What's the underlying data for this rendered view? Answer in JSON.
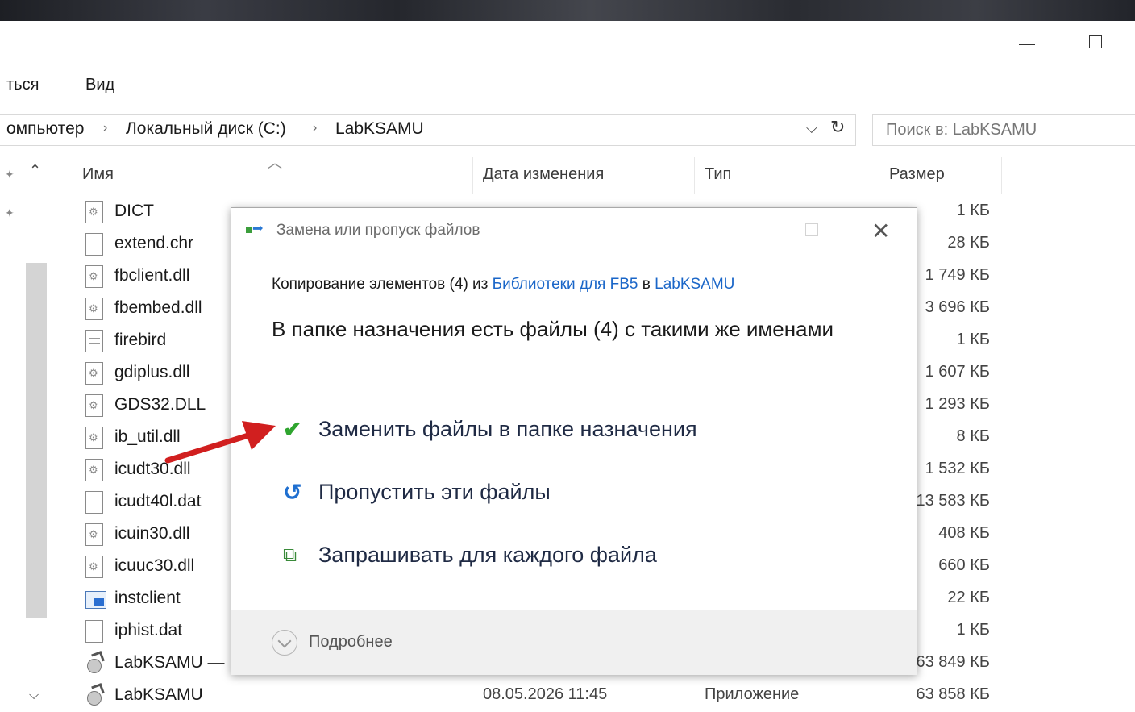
{
  "window": {
    "minimize": "minimize",
    "maximize": "maximize"
  },
  "ribbon": {
    "tab_partial": "ться",
    "tab_view": "Вид"
  },
  "address": {
    "crumb_computer": "омпьютер",
    "crumb_disk": "Локальный диск (C:)",
    "crumb_folder": "LabKSAMU",
    "separator": "›"
  },
  "search": {
    "placeholder": "Поиск в: LabKSAMU"
  },
  "columns": {
    "name": "Имя",
    "date": "Дата изменения",
    "type": "Тип",
    "size": "Размер"
  },
  "files": [
    {
      "name": "DICT",
      "size": "1 КБ",
      "icon": "settings-file-icon"
    },
    {
      "name": "extend.chr",
      "size": "28 КБ",
      "icon": "blank-file-icon"
    },
    {
      "name": "fbclient.dll",
      "size": "1 749 КБ",
      "icon": "dll-file-icon"
    },
    {
      "name": "fbembed.dll",
      "size": "3 696 КБ",
      "icon": "dll-file-icon"
    },
    {
      "name": "firebird",
      "size": "1 КБ",
      "icon": "text-file-icon"
    },
    {
      "name": "gdiplus.dll",
      "size": "1 607 КБ",
      "icon": "dll-file-icon"
    },
    {
      "name": "GDS32.DLL",
      "size": "1 293 КБ",
      "icon": "dll-file-icon"
    },
    {
      "name": "ib_util.dll",
      "size": "8 КБ",
      "icon": "dll-file-icon"
    },
    {
      "name": "icudt30.dll",
      "size": "1 532 КБ",
      "icon": "dll-file-icon"
    },
    {
      "name": "icudt40l.dat",
      "size": "13 583 КБ",
      "icon": "blank-file-icon"
    },
    {
      "name": "icuin30.dll",
      "size": "408 КБ",
      "icon": "dll-file-icon"
    },
    {
      "name": "icuuc30.dll",
      "size": "660 КБ",
      "icon": "dll-file-icon"
    },
    {
      "name": "instclient",
      "size": "22 КБ",
      "icon": "app-file-icon"
    },
    {
      "name": "iphist.dat",
      "size": "1 КБ",
      "icon": "blank-file-icon"
    },
    {
      "name": "LabKSAMU —",
      "size": "63 849 КБ",
      "icon": "exe-file-icon"
    },
    {
      "name": "LabKSAMU",
      "size": "63 858 КБ",
      "icon": "exe-file-icon",
      "date": "08.05.2026 11:45",
      "type": "Приложение"
    }
  ],
  "dialog": {
    "title": "Замена или пропуск файлов",
    "line_prefix": "Копирование элементов (4) из ",
    "source_link": "Библиотеки для FB5",
    "line_middle": " в ",
    "dest_link": "LabKSAMU",
    "heading": "В папке назначения есть файлы (4) с такими же именами",
    "options": {
      "replace": "Заменить файлы в папке назначения",
      "skip": "Пропустить эти файлы",
      "ask": "Запрашивать для каждого файла"
    },
    "more": "Подробнее",
    "close_glyph": "✕"
  },
  "colors": {
    "link": "#1a66c8",
    "check": "#2fa52f",
    "skip": "#1f6fd0",
    "arrow": "#d11f1f"
  }
}
